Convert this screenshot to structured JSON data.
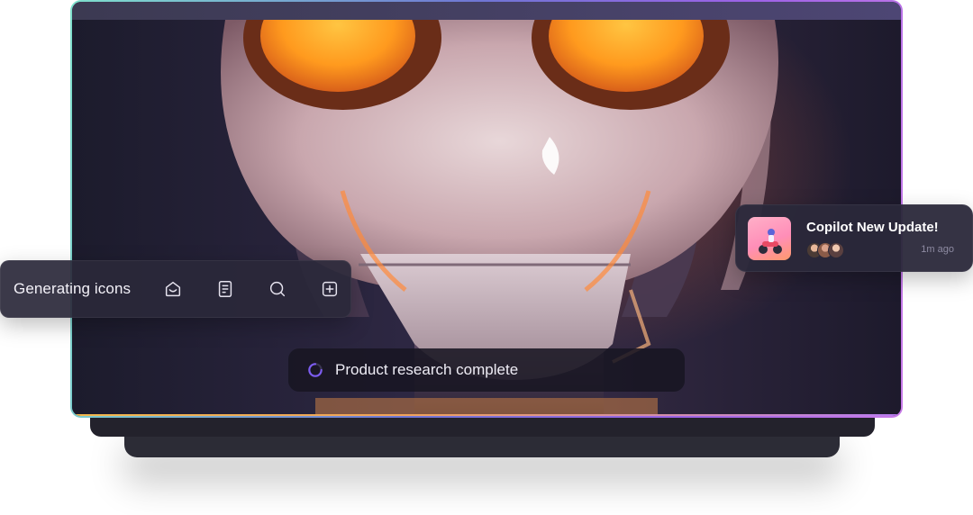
{
  "toolbar": {
    "label": "Generating icons",
    "icons": [
      "inbox-icon",
      "document-icon",
      "search-icon",
      "add-square-icon"
    ]
  },
  "notification": {
    "title": "Copilot New Update!",
    "time": "1m ago",
    "avatars": [
      "avatar-1",
      "avatar-2",
      "avatar-3"
    ]
  },
  "status": {
    "text": "Product research complete",
    "icon": "spinner-icon"
  },
  "colors": {
    "accent_purple": "#7c5cf0",
    "card_bg": "#2a283a",
    "border_gradient": [
      "#7fe0cc",
      "#6f76d4",
      "#9c62e6",
      "#c87ae8"
    ]
  }
}
